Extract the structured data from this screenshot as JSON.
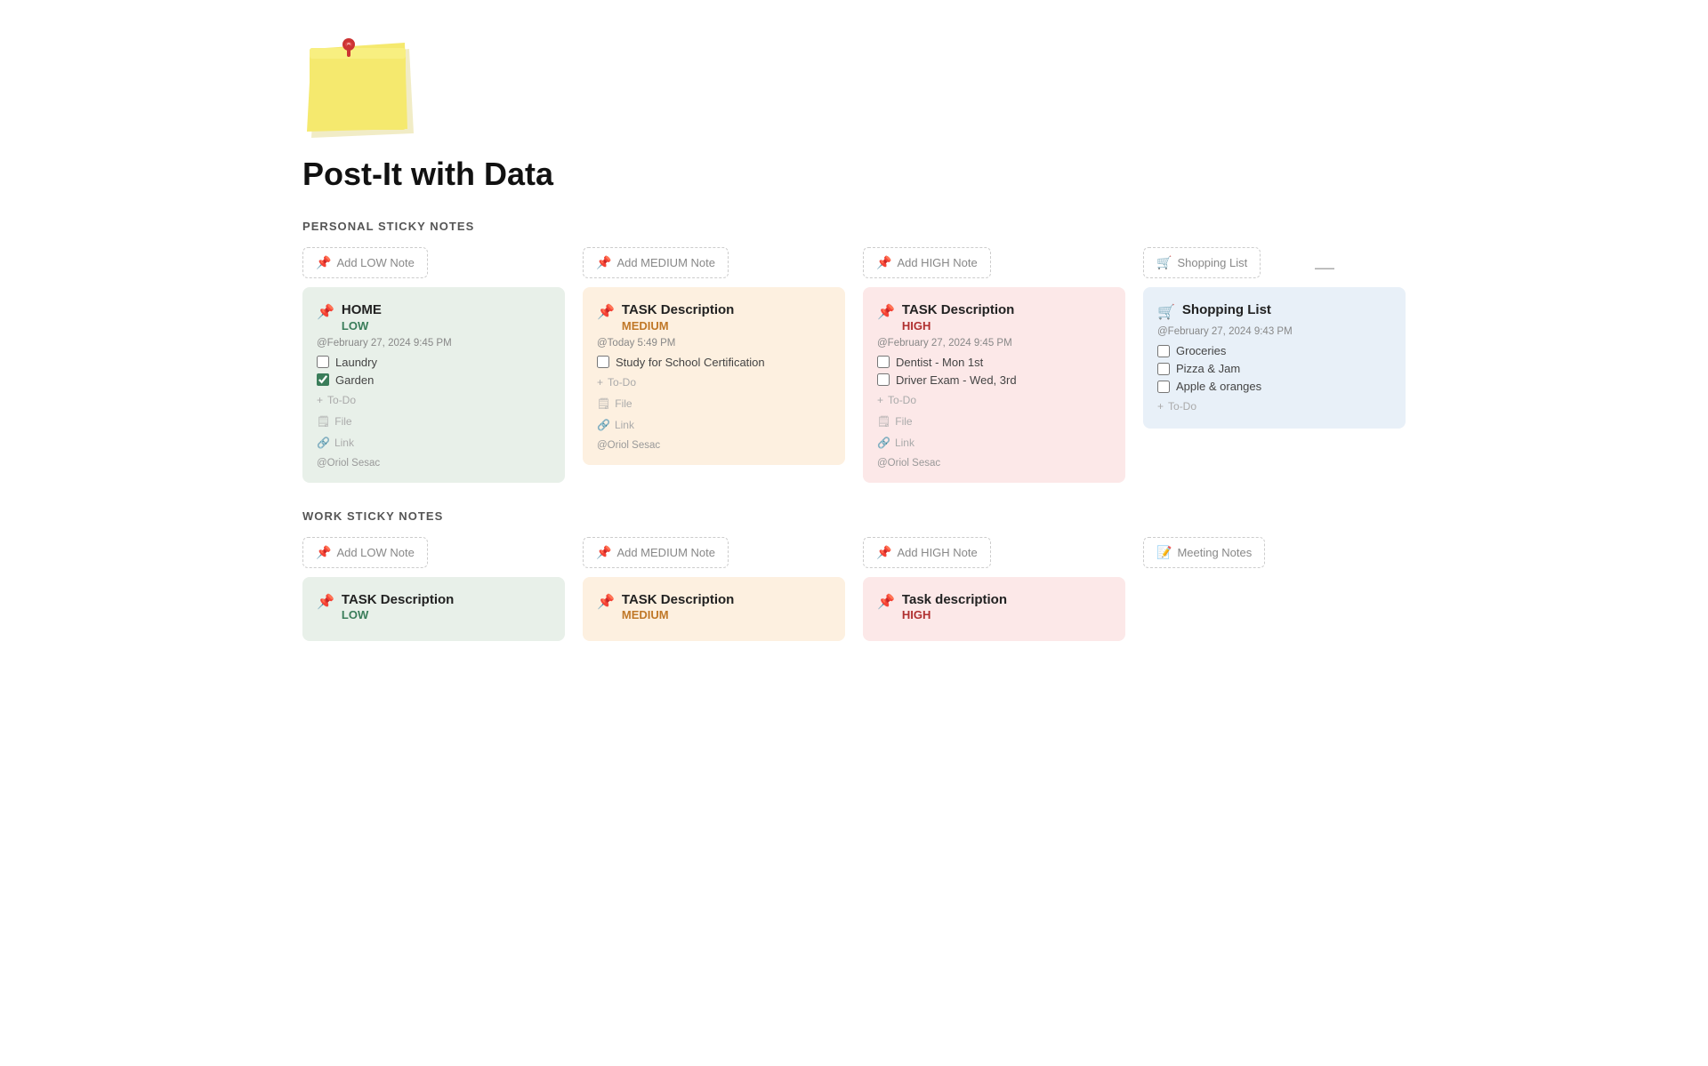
{
  "page": {
    "title": "Post-It with Data",
    "minus_btn": "—"
  },
  "sections": [
    {
      "id": "personal",
      "title": "PERSONAL STICKY NOTES",
      "columns": [
        {
          "id": "personal-low",
          "add_button": "Add LOW Note",
          "add_icon": "📌",
          "cards": [
            {
              "id": "personal-low-1",
              "title": "HOME",
              "subtitle": "LOW",
              "subtitle_class": "subtitle-low",
              "pin_class": "pin-low",
              "card_class": "card-low",
              "date": "@February 27, 2024 9:45 PM",
              "checkboxes": [
                {
                  "label": "Laundry",
                  "checked": false
                },
                {
                  "label": "Garden",
                  "checked": true
                }
              ],
              "actions": [
                "To-Do",
                "File",
                "Link"
              ],
              "author": "@Oriol Sesac"
            }
          ]
        },
        {
          "id": "personal-medium",
          "add_button": "Add MEDIUM Note",
          "add_icon": "📌",
          "cards": [
            {
              "id": "personal-medium-1",
              "title": "TASK Description",
              "subtitle": "MEDIUM",
              "subtitle_class": "subtitle-medium",
              "pin_class": "pin-medium",
              "card_class": "card-medium",
              "date": "@Today 5:49 PM",
              "checkboxes": [
                {
                  "label": "Study for School Certification",
                  "checked": false
                }
              ],
              "actions": [
                "To-Do",
                "File",
                "Link"
              ],
              "author": "@Oriol Sesac"
            }
          ]
        },
        {
          "id": "personal-high",
          "add_button": "Add HIGH Note",
          "add_icon": "📌",
          "cards": [
            {
              "id": "personal-high-1",
              "title": "TASK Description",
              "subtitle": "HIGH",
              "subtitle_class": "subtitle-high",
              "pin_class": "pin-high",
              "card_class": "card-high",
              "date": "@February 27, 2024 9:45 PM",
              "checkboxes": [
                {
                  "label": "Dentist - Mon 1st",
                  "checked": false
                },
                {
                  "label": "Driver Exam - Wed, 3rd",
                  "checked": false
                }
              ],
              "actions": [
                "To-Do",
                "File",
                "Link"
              ],
              "author": "@Oriol Sesac"
            }
          ]
        },
        {
          "id": "personal-shopping",
          "add_button": "Shopping List",
          "add_icon": "🛒",
          "cards": [
            {
              "id": "personal-shopping-1",
              "title": "Shopping List",
              "subtitle": "",
              "subtitle_class": "",
              "pin_class": "pin-shopping",
              "card_class": "card-shopping",
              "date": "@February 27, 2024 9:43 PM",
              "checkboxes": [
                {
                  "label": "Groceries",
                  "checked": false
                },
                {
                  "label": "Pizza & Jam",
                  "checked": false
                },
                {
                  "label": "Apple & oranges",
                  "checked": false
                }
              ],
              "actions": [
                "To-Do"
              ],
              "author": ""
            }
          ]
        }
      ]
    },
    {
      "id": "work",
      "title": "WORK STICKY NOTES",
      "columns": [
        {
          "id": "work-low",
          "add_button": "Add LOW Note",
          "add_icon": "📌",
          "cards": [
            {
              "id": "work-low-1",
              "title": "TASK Description",
              "subtitle": "LOW",
              "subtitle_class": "subtitle-low",
              "pin_class": "pin-low",
              "card_class": "card-low",
              "date": "",
              "checkboxes": [],
              "actions": [],
              "author": ""
            }
          ]
        },
        {
          "id": "work-medium",
          "add_button": "Add MEDIUM Note",
          "add_icon": "📌",
          "cards": [
            {
              "id": "work-medium-1",
              "title": "TASK Description",
              "subtitle": "MEDIUM",
              "subtitle_class": "subtitle-medium",
              "pin_class": "pin-medium",
              "card_class": "card-medium",
              "date": "",
              "checkboxes": [],
              "actions": [],
              "author": ""
            }
          ]
        },
        {
          "id": "work-high",
          "add_button": "Add HIGH Note",
          "add_icon": "📌",
          "cards": [
            {
              "id": "work-high-1",
              "title": "Task description",
              "subtitle": "HIGH",
              "subtitle_class": "subtitle-high",
              "pin_class": "pin-high",
              "card_class": "card-high",
              "date": "",
              "checkboxes": [],
              "actions": [],
              "author": ""
            }
          ]
        },
        {
          "id": "work-meeting",
          "add_button": "Meeting Notes",
          "add_icon": "📝",
          "cards": []
        }
      ]
    }
  ],
  "bottom_section": {
    "col1": {
      "title": "TASK Description",
      "subtitle": "LOW"
    },
    "col2": {
      "title": "TASK Description",
      "subtitle": "MEDIUM"
    }
  },
  "icons": {
    "pin": "📌",
    "cart": "🛒",
    "notes": "📝",
    "todo_plus": "+",
    "file_icon": "🗒",
    "link_icon": "🔗",
    "checkbox_empty": "☐",
    "checkbox_checked": "☑"
  }
}
